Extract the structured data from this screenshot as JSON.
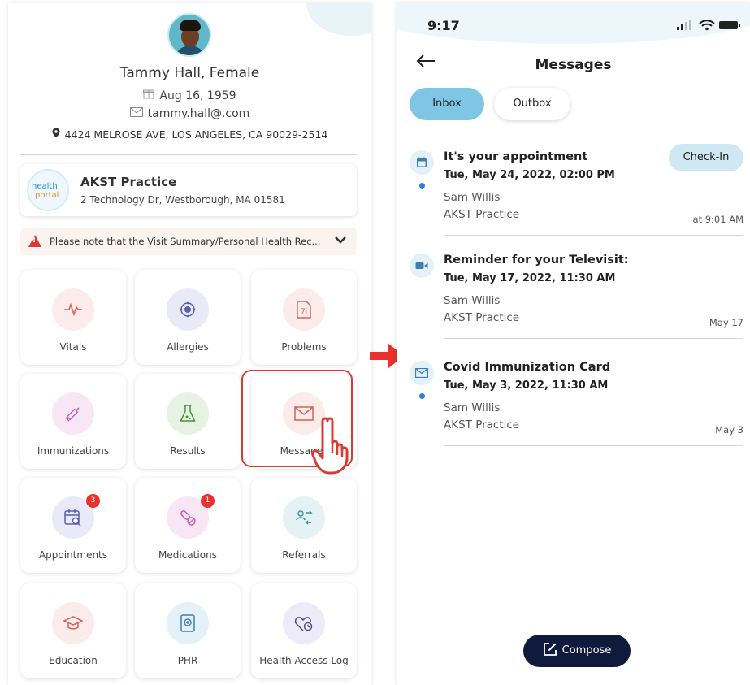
{
  "profile": {
    "name": "Tammy Hall, Female",
    "dob": "Aug 16, 1959",
    "email": "tammy.hall@.com",
    "address": "4424 MELROSE AVE, LOS ANGELES, CA 90029-2514"
  },
  "practice": {
    "logo_line1": "health",
    "logo_line2": "portal",
    "name": "AKST Practice",
    "address": "2 Technology Dr, Westborough, MA 01581"
  },
  "notice": {
    "text": "Please note that the Visit Summary/Personal Health Rec..."
  },
  "tiles": [
    {
      "label": "Vitals",
      "icon": "heartbeat-icon",
      "color": "#fbeceb"
    },
    {
      "label": "Allergies",
      "icon": "allergy-icon",
      "color": "#e9e9f7"
    },
    {
      "label": "Problems",
      "icon": "document-icon",
      "color": "#fbecea"
    },
    {
      "label": "Immunizations",
      "icon": "syringe-icon",
      "color": "#f9e6f5"
    },
    {
      "label": "Results",
      "icon": "flask-icon",
      "color": "#e6f2e2"
    },
    {
      "label": "Messages",
      "icon": "envelope-icon",
      "color": "#fbecea"
    },
    {
      "label": "Appointments",
      "icon": "calendar-search-icon",
      "color": "#e9e9f7",
      "badge": "3"
    },
    {
      "label": "Medications",
      "icon": "pill-icon",
      "color": "#f9e6f5",
      "badge": "1"
    },
    {
      "label": "Referrals",
      "icon": "referral-icon",
      "color": "#e4f2f5"
    },
    {
      "label": "Education",
      "icon": "graduation-cap-icon",
      "color": "#fbeceb"
    },
    {
      "label": "PHR",
      "icon": "phr-icon",
      "color": "#e4f1f8"
    },
    {
      "label": "Health Access Log",
      "icon": "access-log-icon",
      "color": "#ecebf7"
    }
  ],
  "status_bar": {
    "time": "9:17"
  },
  "messages_screen": {
    "title": "Messages",
    "tabs": {
      "inbox": "Inbox",
      "outbox": "Outbox"
    },
    "checkin_label": "Check-In",
    "compose_label": "Compose",
    "items": [
      {
        "subject": "It's your appointment",
        "datetime": "Tue, May 24, 2022, 02:00 PM",
        "sender": "Sam  Willis",
        "practice": "AKST Practice",
        "time": "at 9:01 AM",
        "icon": "calendar-icon"
      },
      {
        "subject": "Reminder for your Televisit:",
        "datetime": "Tue, May 17, 2022, 11:30 AM",
        "sender": "Sam Willis",
        "practice": "AKST Practice",
        "time": "May 17",
        "icon": "video-icon"
      },
      {
        "subject": "Covid Immunization Card",
        "datetime": "Tue, May 3, 2022, 11:30 AM",
        "sender": "Sam Willis",
        "practice": "AKST Practice",
        "time": "May 3",
        "icon": "envelope-icon"
      }
    ]
  },
  "colors": {
    "accent_tab": "#7fc6e4",
    "compose_bg": "#0f1a3c",
    "highlight_red": "#d93a33",
    "unread_dot": "#2f7fd6"
  }
}
